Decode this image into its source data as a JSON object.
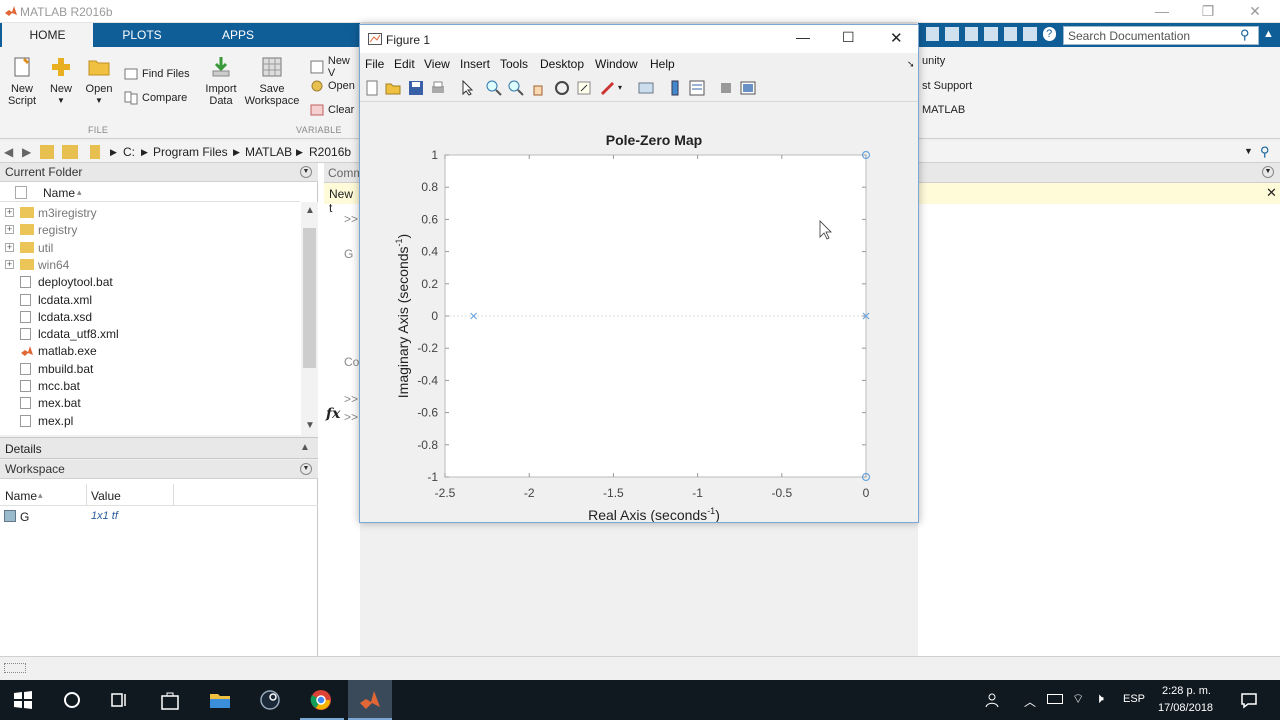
{
  "app": {
    "title": "MATLAB R2016b"
  },
  "ribbon": {
    "tabs": [
      "HOME",
      "PLOTS",
      "APPS"
    ],
    "new_script": "New\nScript",
    "new": "New",
    "open": "Open",
    "find_files": "Find Files",
    "compare": "Compare",
    "import_data": "Import\nData",
    "save_workspace": "Save\nWorkspace",
    "new_var": "New V",
    "open_var": "Open",
    "clear": "Clear",
    "group_file": "FILE",
    "group_variable": "VARIABLE",
    "right_items": [
      "unity",
      "st Support",
      "MATLAB"
    ]
  },
  "search": {
    "placeholder": "Search Documentation"
  },
  "address": {
    "drive": "C:",
    "parts": [
      "Program Files",
      "MATLAB",
      "R2016b"
    ]
  },
  "current_folder": {
    "title": "Current Folder",
    "col_name": "Name",
    "sort_arrow": "▴",
    "items": [
      {
        "name": "m3iregistry",
        "type": "folder"
      },
      {
        "name": "registry",
        "type": "folder"
      },
      {
        "name": "util",
        "type": "folder"
      },
      {
        "name": "win64",
        "type": "folder"
      },
      {
        "name": "deploytool.bat",
        "type": "bat"
      },
      {
        "name": "lcdata.xml",
        "type": "file"
      },
      {
        "name": "lcdata.xsd",
        "type": "file"
      },
      {
        "name": "lcdata_utf8.xml",
        "type": "file"
      },
      {
        "name": "matlab.exe",
        "type": "exe"
      },
      {
        "name": "mbuild.bat",
        "type": "bat"
      },
      {
        "name": "mcc.bat",
        "type": "bat"
      },
      {
        "name": "mex.bat",
        "type": "bat"
      },
      {
        "name": "mex.pl",
        "type": "file"
      }
    ]
  },
  "details": {
    "title": "Details"
  },
  "workspace": {
    "title": "Workspace",
    "col_name": "Name",
    "col_value": "Value",
    "rows": [
      {
        "name": "G",
        "value": "1x1 tf"
      }
    ]
  },
  "command": {
    "header": "Comm",
    "new_label": "New t",
    "prompt": ">>",
    "var": "G",
    "c": "Co",
    "fx": "fx"
  },
  "figure": {
    "title": "Figure 1",
    "menu": [
      "File",
      "Edit",
      "View",
      "Insert",
      "Tools",
      "Desktop",
      "Window",
      "Help"
    ],
    "plot_title": "Pole-Zero Map",
    "xlabel_main": "Real Axis (seconds",
    "xlabel_sup": "-1",
    "xlabel_close": ")",
    "ylabel_main": "Imaginary Axis (seconds",
    "ylabel_sup": "-1",
    "ylabel_close": ")"
  },
  "chart_data": {
    "type": "scatter",
    "title": "Pole-Zero Map",
    "xlabel": "Real Axis (seconds-1)",
    "ylabel": "Imaginary Axis (seconds-1)",
    "xlim": [
      -2.5,
      0
    ],
    "ylim": [
      -1,
      1
    ],
    "xticks": [
      "-2.5",
      "-2",
      "-1.5",
      "-1",
      "-0.5",
      "0"
    ],
    "yticks": [
      "1",
      "0.8",
      "0.6",
      "0.4",
      "0.2",
      "0",
      "-0.2",
      "-0.4",
      "-0.6",
      "-0.8",
      "-1"
    ],
    "poles": [
      {
        "x": -2.33,
        "y": 0
      },
      {
        "x": 0,
        "y": 0
      }
    ],
    "zeros": [
      {
        "x": 0,
        "y": 1
      },
      {
        "x": 0,
        "y": -1
      }
    ],
    "marker_color": "#6aa6e0",
    "grid": false
  },
  "taskbar": {
    "lang": "ESP",
    "time": "2:28 p. m.",
    "date": "17/08/2018"
  },
  "colors": {
    "ribbon_blue": "#0f5e98",
    "taskbar": "#101820",
    "plot_marker": "#6aa6e0"
  }
}
